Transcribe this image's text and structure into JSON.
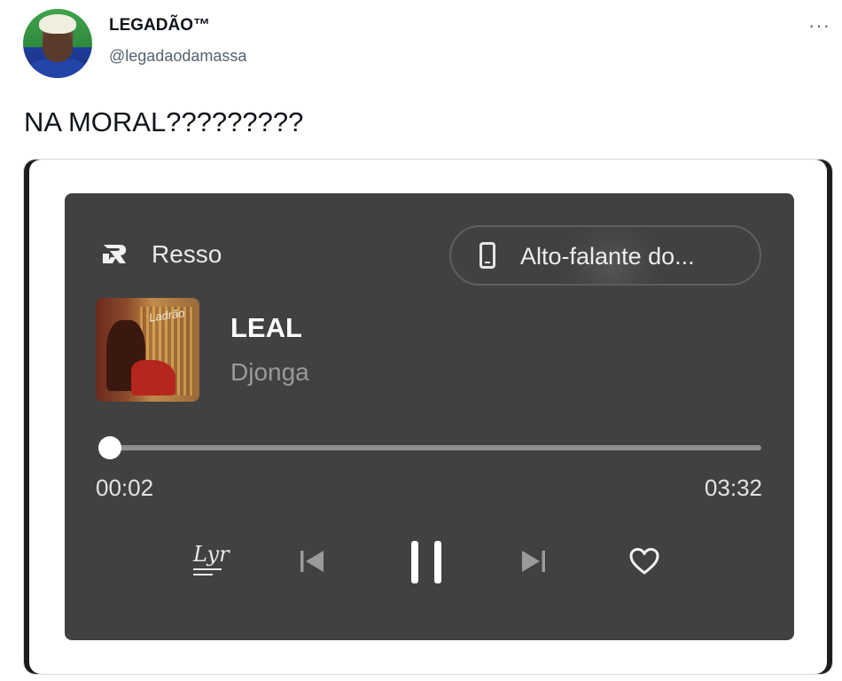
{
  "tweet": {
    "author_name": "LEGADÃO™",
    "author_handle": "@legadaodamassa",
    "more_glyph": "···",
    "text": "NA MORAL?????????"
  },
  "player": {
    "app_name": "Resso",
    "app_icon": "resso-logo-icon",
    "output_device_label": "Alto-falante do...",
    "output_device_icon": "phone-icon",
    "track_title": "LEAL",
    "track_artist": "Djonga",
    "album_art_scrawl": "Ladrão",
    "elapsed": "00:02",
    "duration": "03:32",
    "progress_fraction": 0.01,
    "controls": {
      "lyrics_label": "Lyr",
      "lyrics_icon": "lyrics-icon",
      "prev_icon": "skip-previous-icon",
      "pause_icon": "pause-icon",
      "next_icon": "skip-next-icon",
      "like_icon": "heart-icon"
    },
    "colors": {
      "panel_bg": "#414141",
      "track_bg": "#8f8f8f",
      "knob": "#ffffff",
      "muted_text": "#9a9a9a"
    }
  }
}
